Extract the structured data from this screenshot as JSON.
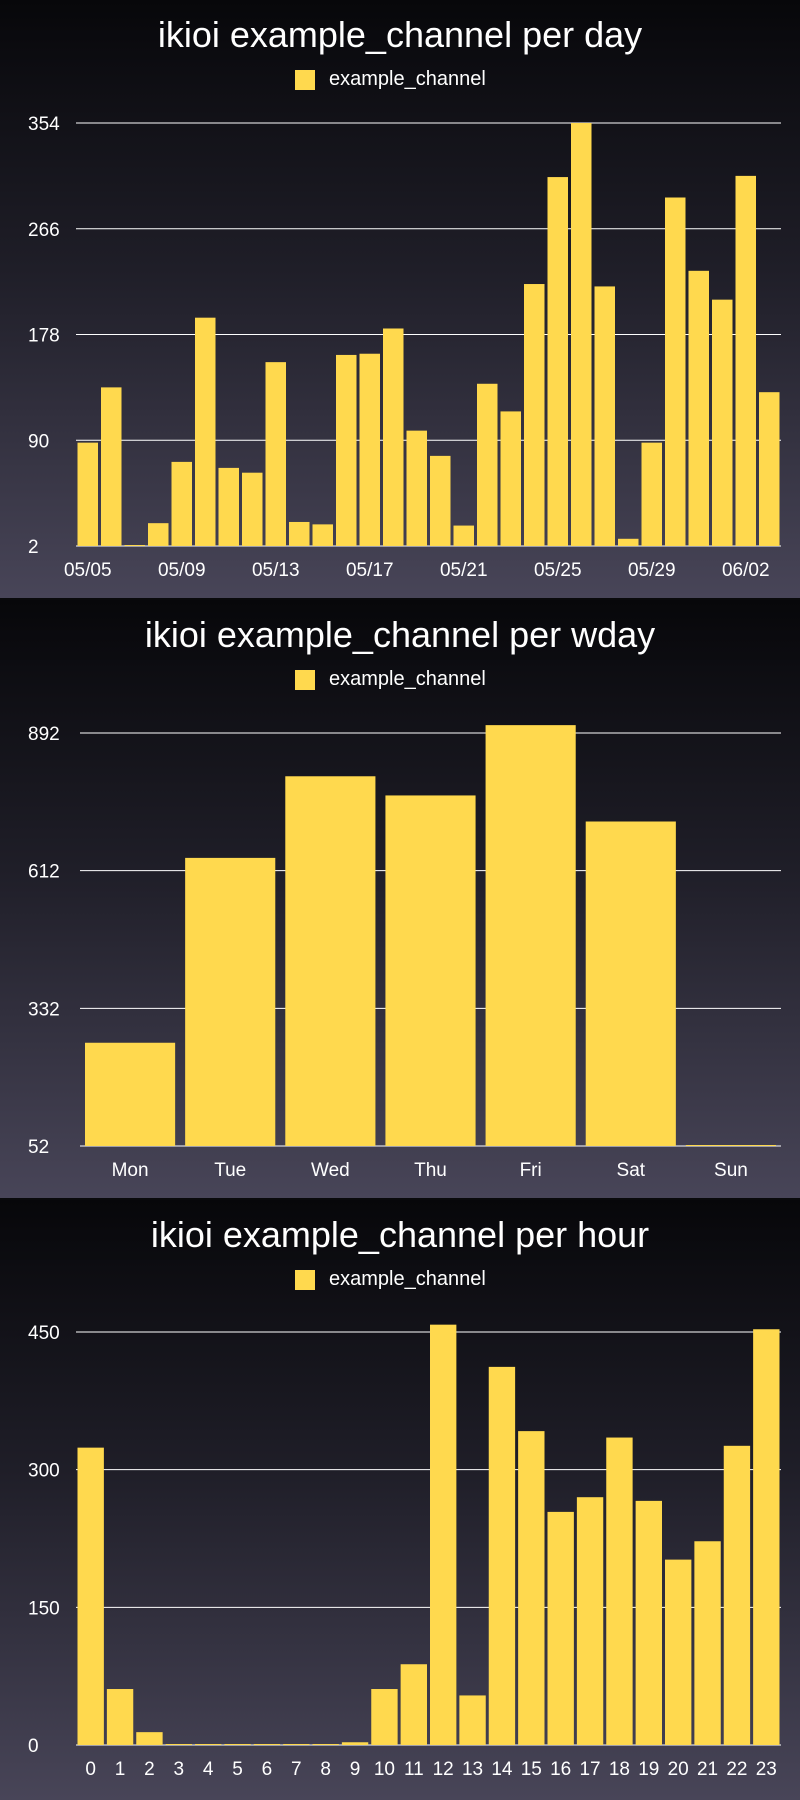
{
  "charts": [
    {
      "title": "ikioi example_channel per day",
      "legend": "example_channel",
      "color": "#ffd94e",
      "chart_data": {
        "type": "bar",
        "title": "ikioi example_channel per day",
        "series": [
          {
            "name": "example_channel",
            "values": [
              88,
              134,
              2,
              21,
              72,
              192,
              67,
              63,
              155,
              22,
              20,
              161,
              162,
              183,
              98,
              77,
              19,
              137,
              114,
              220,
              309,
              354,
              218,
              8,
              88,
              292,
              231,
              207,
              310,
              130
            ]
          }
        ],
        "categories": [
          "05/05",
          "05/06",
          "05/07",
          "05/08",
          "05/09",
          "05/10",
          "05/11",
          "05/12",
          "05/13",
          "05/14",
          "05/15",
          "05/16",
          "05/17",
          "05/18",
          "05/19",
          "05/20",
          "05/21",
          "05/22",
          "05/23",
          "05/24",
          "05/25",
          "05/26",
          "05/27",
          "05/28",
          "05/29",
          "05/30",
          "05/31",
          "06/01",
          "06/02",
          "06/03"
        ],
        "xtick_labels": [
          "05/05",
          "05/09",
          "05/13",
          "05/17",
          "05/21",
          "05/25",
          "05/29",
          "06/02"
        ],
        "xtick_indices": [
          0,
          4,
          8,
          12,
          16,
          20,
          24,
          28
        ],
        "yticks": [
          2,
          90,
          178,
          266,
          354
        ],
        "ylim": [
          2,
          354
        ],
        "grid": true,
        "legend_position": "top-center"
      }
    },
    {
      "title": "ikioi example_channel per wday",
      "legend": "example_channel",
      "color": "#ffd94e",
      "chart_data": {
        "type": "bar",
        "title": "ikioi example_channel per wday",
        "series": [
          {
            "name": "example_channel",
            "values": [
              262,
              638,
              804,
              765,
              908,
              712,
              53
            ]
          }
        ],
        "categories": [
          "Mon",
          "Tue",
          "Wed",
          "Thu",
          "Fri",
          "Sat",
          "Sun"
        ],
        "xtick_labels": [
          "Mon",
          "Tue",
          "Wed",
          "Thu",
          "Fri",
          "Sat",
          "Sun"
        ],
        "xtick_indices": [
          0,
          1,
          2,
          3,
          4,
          5,
          6
        ],
        "yticks": [
          52,
          332,
          612,
          892
        ],
        "ylim": [
          52,
          892
        ],
        "grid": true,
        "legend_position": "top-center"
      }
    },
    {
      "title": "ikioi example_channel per hour",
      "legend": "example_channel",
      "color": "#ffd94e",
      "chart_data": {
        "type": "bar",
        "title": "ikioi example_channel per hour",
        "series": [
          {
            "name": "example_channel",
            "values": [
              324,
              61,
              14,
              1,
              1,
              1,
              1,
              1,
              1,
              3,
              61,
              88,
              458,
              54,
              412,
              342,
              254,
              270,
              335,
              266,
              202,
              222,
              326,
              453
            ]
          }
        ],
        "categories": [
          "0",
          "1",
          "2",
          "3",
          "4",
          "5",
          "6",
          "7",
          "8",
          "9",
          "10",
          "11",
          "12",
          "13",
          "14",
          "15",
          "16",
          "17",
          "18",
          "19",
          "20",
          "21",
          "22",
          "23"
        ],
        "xtick_labels": [
          "0",
          "1",
          "2",
          "3",
          "4",
          "5",
          "6",
          "7",
          "8",
          "9",
          "10",
          "11",
          "12",
          "13",
          "14",
          "15",
          "16",
          "17",
          "18",
          "19",
          "20",
          "21",
          "22",
          "23"
        ],
        "xtick_indices": [
          0,
          1,
          2,
          3,
          4,
          5,
          6,
          7,
          8,
          9,
          10,
          11,
          12,
          13,
          14,
          15,
          16,
          17,
          18,
          19,
          20,
          21,
          22,
          23
        ],
        "yticks": [
          0,
          150,
          300,
          450
        ],
        "ylim": [
          0,
          450
        ],
        "grid": true,
        "legend_position": "top-center"
      }
    }
  ]
}
